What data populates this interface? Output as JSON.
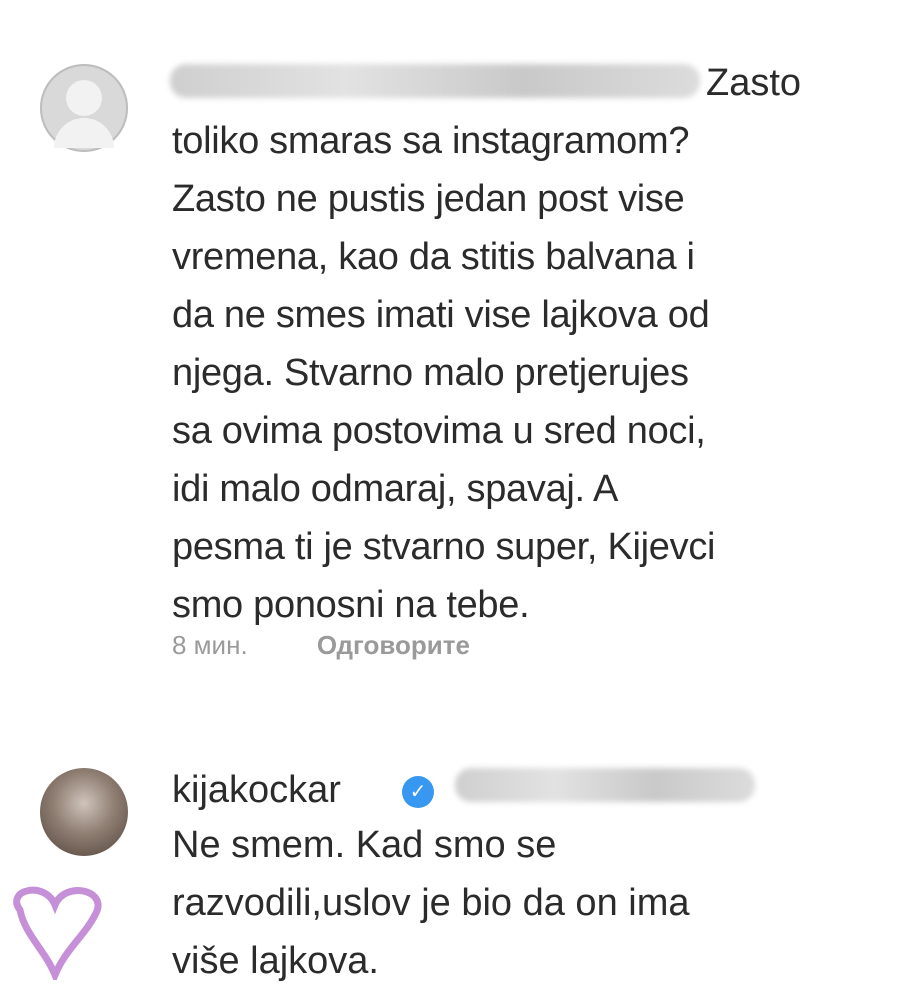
{
  "comment1": {
    "lead_word": "Zasto",
    "lines": [
      "toliko smaras sa instagramom?",
      "Zasto ne pustis jedan post vise",
      "vremena, kao da stitis balvana i",
      "da ne smes imati vise lajkova od",
      "njega. Stvarno malo pretjerujes",
      "sa ovima postovima u sred noci,",
      "idi malo odmaraj, spavaj. A",
      "pesma ti je stvarno super, Kijevci",
      "smo ponosni na tebe."
    ],
    "time": "8 мин.",
    "reply_label": "Одговорите"
  },
  "comment2": {
    "username": "kijakockar",
    "verified_icon": "verified-badge-icon",
    "lines": [
      "Ne smem. Kad smo se",
      "razvodili,uslov je bio da on ima",
      "više lajkova."
    ]
  },
  "colors": {
    "text": "#2b2b2b",
    "meta": "#9a9a9a",
    "verified": "#3897f0",
    "heart_outline": "#c690d9"
  }
}
